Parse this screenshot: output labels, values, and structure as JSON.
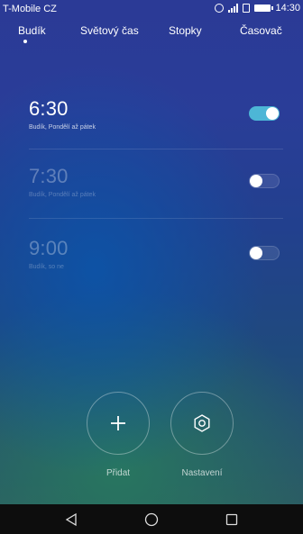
{
  "status_bar": {
    "carrier": "T-Mobile CZ",
    "time": "14:30",
    "icons": [
      "alarm-icon",
      "signal-icon",
      "sim-icon",
      "battery-icon"
    ]
  },
  "tabs": [
    {
      "label": "Budík",
      "selected": true
    },
    {
      "label": "Světový čas",
      "selected": false
    },
    {
      "label": "Stopky",
      "selected": false
    },
    {
      "label": "Časovač",
      "selected": false
    }
  ],
  "alarms": [
    {
      "time": "6:30",
      "desc": "Budík, Pondělí až pátek",
      "enabled": true
    },
    {
      "time": "7:30",
      "desc": "Budík, Pondělí až pátek",
      "enabled": false
    },
    {
      "time": "9:00",
      "desc": "Budík, so ne",
      "enabled": false
    }
  ],
  "actions": {
    "add_label": "Přidat",
    "settings_label": "Nastavení"
  },
  "nav": [
    "back-icon",
    "home-icon",
    "recents-icon"
  ],
  "colors": {
    "toggle_on": "#4db6d6",
    "background_top": "#2b3a96",
    "background_bottom": "#2b5a63"
  }
}
